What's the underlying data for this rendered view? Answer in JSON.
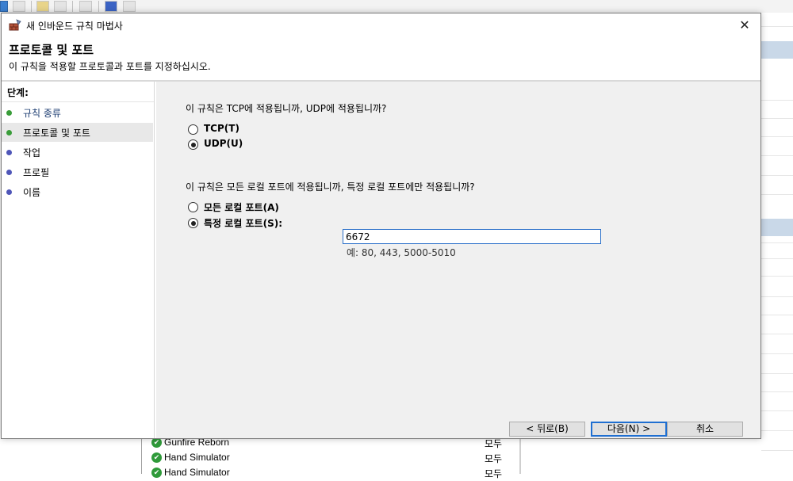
{
  "dialog": {
    "title": "새 인바운드 규칙 마법사",
    "heading": "프로토콜 및 포트",
    "subheading": "이 규칙을 적용할 프로토콜과 포트를 지정하십시오.",
    "close_glyph": "✕"
  },
  "steps": {
    "label": "단계:",
    "items": [
      {
        "label": "규칙 종류",
        "state": "done"
      },
      {
        "label": "프로토콜 및 포트",
        "state": "active"
      },
      {
        "label": "작업",
        "state": "pending"
      },
      {
        "label": "프로필",
        "state": "pending"
      },
      {
        "label": "이름",
        "state": "pending"
      }
    ]
  },
  "protocol": {
    "question": "이 규칙은 TCP에 적용됩니까, UDP에 적용됩니까?",
    "options": [
      {
        "label": "TCP(T)",
        "selected": false
      },
      {
        "label": "UDP(U)",
        "selected": true
      }
    ]
  },
  "ports": {
    "question": "이 규칙은 모든 로컬 포트에 적용됩니까, 특정 로컬 포트에만 적용됩니까?",
    "options": [
      {
        "label": "모든 로컬 포트(A)",
        "selected": false
      },
      {
        "label": "특정 로컬 포트(S):",
        "selected": true
      }
    ],
    "value": "6672",
    "hint": "예: 80, 443, 5000-5010"
  },
  "buttons": {
    "back": "< 뒤로(B)",
    "next": "다음(N) >",
    "cancel": "취소"
  },
  "background_list": [
    {
      "name": "Gunfire Reborn",
      "profile": "모두"
    },
    {
      "name": "Hand Simulator",
      "profile": "모두"
    },
    {
      "name": "Hand Simulator",
      "profile": "모두"
    }
  ],
  "colors": {
    "step_done": "#3a9d3a",
    "step_pending": "#4f56b8",
    "accent": "#1f6fd1"
  },
  "icons": {
    "title": "firewall-wizard-icon",
    "check": "allow-check-icon"
  }
}
